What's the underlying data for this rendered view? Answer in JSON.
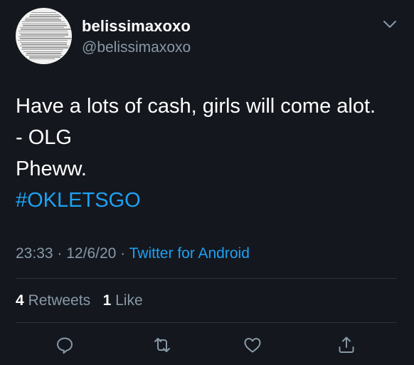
{
  "user": {
    "display_name": "belissimaxoxo",
    "handle": "@belissimaxoxo"
  },
  "tweet": {
    "lines": [
      "Have a lots of cash, girls will come alot.",
      "- OLG",
      "Pheww."
    ],
    "hashtag": "#OKLETSGO"
  },
  "meta": {
    "time": "23:33",
    "date": "12/6/20",
    "separator": "·",
    "source": "Twitter for Android"
  },
  "stats": {
    "retweets_count": "4",
    "retweets_label": "Retweets",
    "likes_count": "1",
    "likes_label": "Like"
  },
  "icons": {
    "chevron": "chevron-down-icon",
    "reply": "reply-icon",
    "retweet": "retweet-icon",
    "like": "heart-icon",
    "share": "share-icon"
  },
  "colors": {
    "background": "#14171e",
    "accent": "#1da1f2",
    "muted": "#8899a6"
  }
}
